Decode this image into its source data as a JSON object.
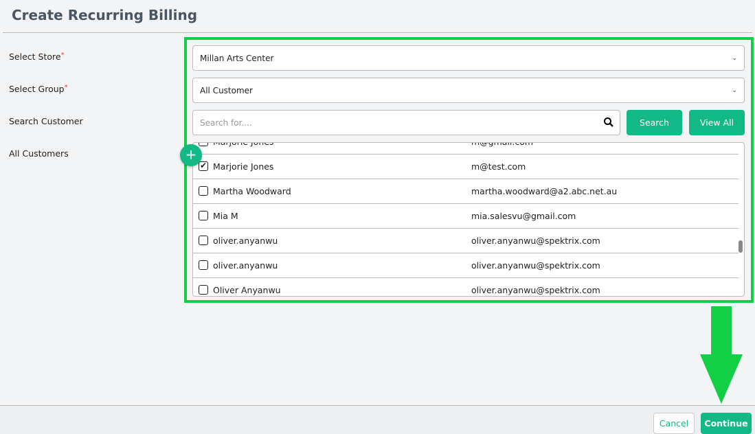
{
  "header": {
    "title": "Create Recurring Billing"
  },
  "form": {
    "store_label": "Select Store",
    "group_label": "Select Group",
    "search_label": "Search Customer",
    "customers_label": "All Customers",
    "required_mark": "*",
    "store_value": "Millan Arts Center",
    "group_value": "All Customer",
    "search_placeholder": "Search for....",
    "search_button": "Search",
    "view_all_button": "View All"
  },
  "customers": [
    {
      "name": "Marjorie Jones",
      "email": "m@gmail.com",
      "checked": false
    },
    {
      "name": "Marjorie Jones",
      "email": "m@test.com",
      "checked": true
    },
    {
      "name": "Martha Woodward",
      "email": "martha.woodward@a2.abc.net.au",
      "checked": false
    },
    {
      "name": "Mia M",
      "email": "mia.salesvu@gmail.com",
      "checked": false
    },
    {
      "name": "oliver.anyanwu",
      "email": "oliver.anyanwu@spektrix.com",
      "checked": false
    },
    {
      "name": "oliver.anyanwu",
      "email": "oliver.anyanwu@spektrix.com",
      "checked": false
    },
    {
      "name": "Oliver Anyanwu",
      "email": "oliver.anyanwu@spektrix.com",
      "checked": false
    }
  ],
  "footer": {
    "cancel": "Cancel",
    "continue": "Continue"
  },
  "colors": {
    "accent": "#12b886",
    "highlight": "#12cf46"
  }
}
